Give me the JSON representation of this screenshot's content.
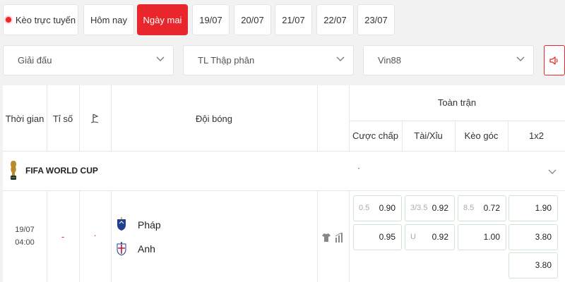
{
  "tabs": {
    "live": "Kèo trực tuyến",
    "today": "Hôm nay",
    "tomorrow": "Ngày mai",
    "dates": [
      "19/07",
      "20/07",
      "21/07",
      "22/07",
      "23/07"
    ]
  },
  "filters": {
    "league": "Giải đấu",
    "odds_type": "TL Thập phân",
    "bookmaker": "Vin88"
  },
  "table": {
    "headers": {
      "time": "Thời gian",
      "score": "Tỉ số",
      "teams": "Đội bóng",
      "full_match": "Toàn trận",
      "handicap": "Cược chấp",
      "over_under": "Tài/Xỉu",
      "corner": "Kèo góc",
      "one_x_two": "1x2"
    },
    "league": {
      "name": "FIFA WORLD CUP",
      "dot": "·"
    },
    "match": {
      "date": "19/07",
      "time": "04:00",
      "score": "-",
      "corner_mark": "·",
      "home": "Pháp",
      "away": "Anh",
      "handicap": {
        "line": "0.5",
        "home": "0.90",
        "away": "0.95"
      },
      "over_under": {
        "line": "3/3.5",
        "over": "0.92",
        "under_label": "U",
        "under": "0.92"
      },
      "corner": {
        "line": "8.5",
        "over": "0.72",
        "under": "1.00"
      },
      "one_x_two": {
        "home": "1.90",
        "away": "3.80",
        "draw": "3.80"
      }
    }
  },
  "colors": {
    "accent": "#e8262c",
    "odds_border": "#cfe5d3",
    "france_blue": "#1f3f8f",
    "england_red": "#c8102e"
  }
}
